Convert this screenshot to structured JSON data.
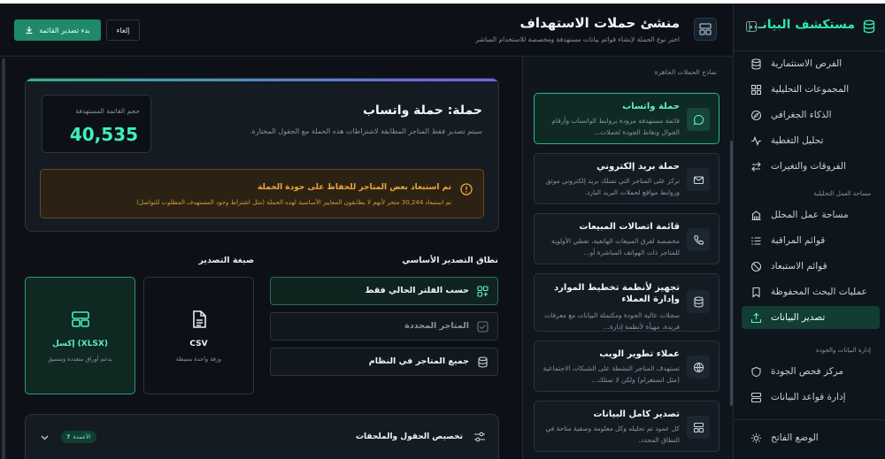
{
  "sidebar": {
    "app_title": "مستكشف البيانـ..",
    "items_top": [
      {
        "label": "الفرص الاستثمارية",
        "icon": "database-icon"
      },
      {
        "label": "المجموعات التحليلية",
        "icon": "grid-icon"
      },
      {
        "label": "الذكاء الجغرافي",
        "icon": "compass-icon"
      },
      {
        "label": "تحليل التغطية",
        "icon": "pulse-icon"
      },
      {
        "label": "الفروقات والتغيرات",
        "icon": "arrows-icon"
      }
    ],
    "section_workspace": "مساحة العمل التحليلية",
    "items_workspace": [
      {
        "label": "مساحة عمل المحلل",
        "icon": "building-icon"
      },
      {
        "label": "قوائم المراقبة",
        "icon": "list-icon"
      },
      {
        "label": "قوائم الاستبعاد",
        "icon": "block-icon"
      },
      {
        "label": "عمليات البحث المحفوظة",
        "icon": "bookmark-icon"
      },
      {
        "label": "تصدير البيانات",
        "icon": "export-icon",
        "active": true
      }
    ],
    "section_data": "إدارة البيانات والجودة",
    "items_data": [
      {
        "label": "مركز فحص الجودة",
        "icon": "shield-icon"
      },
      {
        "label": "إدارة قواعد البيانات",
        "icon": "server-icon"
      }
    ],
    "theme_toggle": "الوضع الفاتح"
  },
  "header": {
    "title": "منشئ حملات الاستهداف",
    "subtitle": "اختر نوع الحملة لإنشاء قوائم بيانات مستهدفة ومخصصة للاستخدام المباشر",
    "export_button": "بدء تصدير القائمة",
    "cancel_button": "إلغاء"
  },
  "templates": {
    "heading": "نماذج الحملات الجاهزة",
    "cards": [
      {
        "title": "حملة واتساب",
        "desc": "قائمة مستهدفة مزودة بروابط الواتساب وأرقام الجوال ونقاط الجودة لحملات...",
        "icon": "chat-icon",
        "active": true
      },
      {
        "title": "حملة بريد إلكتروني",
        "desc": "تركز على المتاجر التي تمتلك بريد إلكتروني موثق وروابط مواقع لحملات البريد البارد.",
        "icon": "mail-icon"
      },
      {
        "title": "قائمة اتصالات المبيعات",
        "desc": "مخصصة لفرق المبيعات الهاتفية، تعطي الأولوية للمتاجر ذات الهواتف المباشرة أو...",
        "icon": "phone-icon"
      },
      {
        "title": "تجهيز لأنظمة تخطيط الموارد وإدارة العملاء",
        "desc": "سجلات عالية الجودة ومكتملة البيانات مع معرفات فريدة، مهيأة لأنظمة إدارة...",
        "icon": "database-icon"
      },
      {
        "title": "عملاء تطوير الويب",
        "desc": "تستهدف المتاجر النشطة على الشبكات الاجتماعية (مثل انستغرام) ولكن لا تمتلك...",
        "icon": "globe-icon"
      },
      {
        "title": "تصدير كامل البيانات",
        "desc": "كل عمود تم تحليله وكل معلومة وصفية متاحة في النطاق المحدد.",
        "icon": "layout-icon"
      }
    ]
  },
  "summary": {
    "title": "حملة: حملة واتساب",
    "description": "سيتم تصدير فقط المتاجر المطابقة لاشتراطات هذه الحملة مع الحقول المختارة.",
    "count_label": "حجم القائمة المستهدفة",
    "count_value": "40,535",
    "warning_title": "تم استبعاد بعض المتاجر للحفاظ على جودة الحملة",
    "warning_text": "تم استبعاد 30,244 متجر لأنهم لا يطابقون المعايير الأساسية لهذه الحملة (مثل اشتراط وجود المستهدف المطلوب للتواصل)"
  },
  "scope": {
    "heading": "نطاق التصدير الأساسي",
    "options": [
      {
        "label": "حسب الفلتر الحالي فقط",
        "icon": "filter-icon",
        "active": true
      },
      {
        "label": "المتاجر المحددة",
        "icon": "checkbox-icon",
        "dim": true
      },
      {
        "label": "جميع المتاجر في النظام",
        "icon": "database-icon"
      }
    ]
  },
  "format": {
    "heading": "صيغة التصدير",
    "options": [
      {
        "label": "CSV",
        "desc": "ورقة واحدة بسيطة",
        "icon": "file-icon"
      },
      {
        "label": "إكسل (XLSX)",
        "desc": "يدعم أوراق متعددة وتنسيق",
        "icon": "layout-icon",
        "active": true
      }
    ]
  },
  "fields": {
    "title": "تخصيص الحقول والملحقات",
    "badge_label": "الأعمدة",
    "badge_count": "7"
  }
}
